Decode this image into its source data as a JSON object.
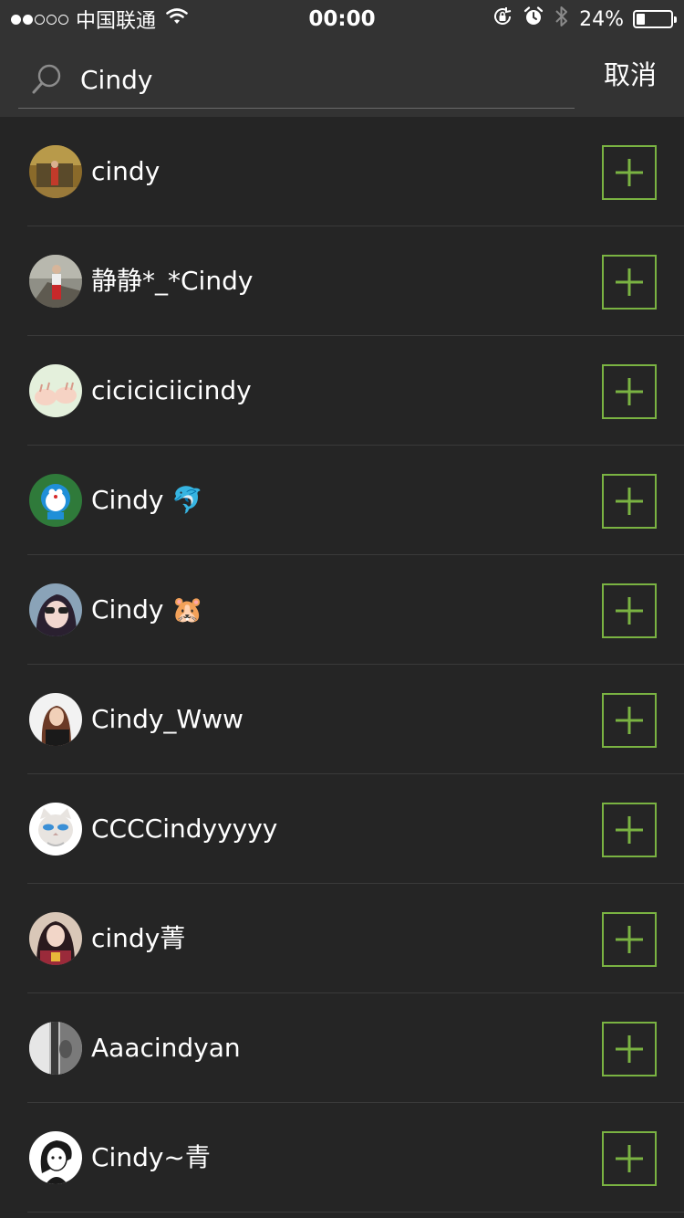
{
  "status_bar": {
    "carrier": "中国联通",
    "time": "00:00",
    "battery_percent": "24%",
    "battery_level": 0.24,
    "signal_bars_filled": 2,
    "signal_bars_total": 5,
    "icons": [
      "wifi-icon",
      "orientation-lock-icon",
      "alarm-icon",
      "bluetooth-icon",
      "battery-icon"
    ]
  },
  "search": {
    "query": "Cindy",
    "cancel_label": "取消",
    "icon": "search-icon"
  },
  "colors": {
    "background": "#252525",
    "header": "#333333",
    "accent_green": "#7ab342"
  },
  "results": [
    {
      "name": "cindy"
    },
    {
      "name": "静静*_*Cindy"
    },
    {
      "name": "ciciciciicindy"
    },
    {
      "name": "Cindy 🐬"
    },
    {
      "name": "Cindy 🐹"
    },
    {
      "name": "Cindy_Www"
    },
    {
      "name": "CCCCindyyyyy"
    },
    {
      "name": "cindy菁"
    },
    {
      "name": "Aaacindyan"
    },
    {
      "name": "Cindy~青"
    }
  ],
  "add_button_icon": "plus-icon"
}
